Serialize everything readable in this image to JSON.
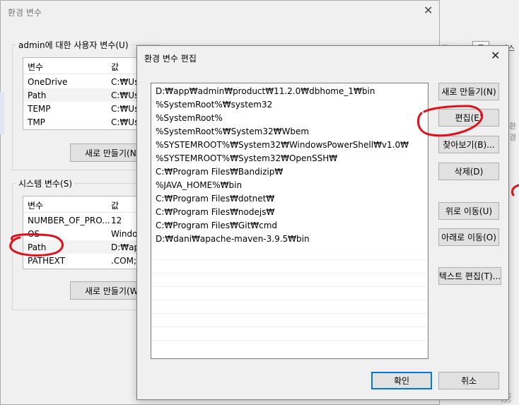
{
  "bg_window": {
    "title": "환경 변수",
    "user_group_label": "admin에 대한 사용자 변수(U)",
    "user_list": {
      "headers": [
        "변수",
        "값"
      ],
      "rows": [
        {
          "name": "OneDrive",
          "value": "C:₩Use"
        },
        {
          "name": "Path",
          "value": "C:₩Use"
        },
        {
          "name": "TEMP",
          "value": "C:₩Use"
        },
        {
          "name": "TMP",
          "value": "C:₩Use"
        }
      ]
    },
    "user_new_button": "새로 만들기(N)",
    "system_group_label": "시스템 변수(S)",
    "system_list": {
      "headers": [
        "변수",
        "값"
      ],
      "rows": [
        {
          "name": "NUMBER_OF_PRO...",
          "value": "12"
        },
        {
          "name": "OS",
          "value": "Window"
        },
        {
          "name": "Path",
          "value": "D:₩app"
        },
        {
          "name": "PATHEXT",
          "value": ".COM;.I"
        }
      ]
    },
    "system_new_button": "새로 만들기(W"
  },
  "peek": {
    "line1": "드(%)",
    "line2": "그",
    "line3": "자스",
    "line4": "환경"
  },
  "dialog": {
    "title": "환경 변수 편집",
    "path_entries": [
      "D:₩app₩admin₩product₩11.2.0₩dbhome_1₩bin",
      "%SystemRoot%₩system32",
      "%SystemRoot%",
      "%SystemRoot%₩System32₩Wbem",
      "%SYSTEMROOT%₩System32₩WindowsPowerShell₩v1.0₩",
      "%SYSTEMROOT%₩System32₩OpenSSH₩",
      "C:₩Program Files₩Bandizip₩",
      "%JAVA_HOME%₩bin",
      "C:₩Program Files₩dotnet₩",
      "C:₩Program Files₩nodejs₩",
      "C:₩Program Files₩Git₩cmd",
      "D:₩dani₩apache-maven-3.9.5₩bin"
    ],
    "buttons": {
      "new": "새로 만들기(N)",
      "edit": "편집(E)",
      "browse": "찾아보기(B)...",
      "delete": "삭제(D)",
      "move_up": "위로 이동(U)",
      "move_down": "아래로 이동(O)",
      "edit_text": "텍스트 편집(T)...",
      "ok": "확인",
      "cancel": "취소"
    }
  },
  "colors": {
    "window_bg": "#f0f0f0",
    "focus_border": "#0078d7",
    "annotation": "#e0101a"
  }
}
